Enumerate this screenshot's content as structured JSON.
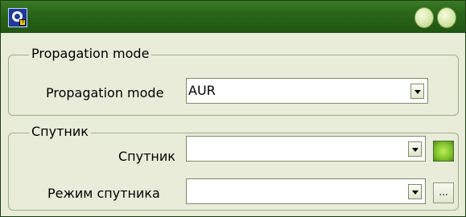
{
  "window": {
    "buttons": [
      "minimize",
      "close"
    ]
  },
  "propagation_group": {
    "title": "Propagation mode",
    "field_label": "Propagation mode",
    "field_value": "AUR"
  },
  "satellite_group": {
    "title": "Спутник",
    "satellite_label": "Спутник",
    "satellite_value": "",
    "mode_label": "Режим спутника",
    "mode_value": "",
    "browse_label": "..."
  }
}
